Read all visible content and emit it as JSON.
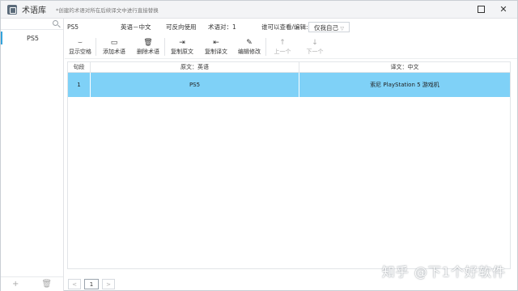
{
  "titlebar": {
    "title": "术语库",
    "subtitle": "*创建的术语对所在后续译文中进行直接替换"
  },
  "sidebar": {
    "items": [
      {
        "label": "PS5"
      }
    ]
  },
  "info": {
    "term_name": "PS5",
    "language_pair": "英语－中文",
    "reversible": "可反向使用",
    "term_count": "术语对：1",
    "visibility_label": "谁可以查看/编辑:",
    "visibility_value": "仅我自己"
  },
  "toolbar": {
    "show_space": "显示空格",
    "add_term": "添加术语",
    "delete_term": "删除术语",
    "copy_source": "复制原文",
    "copy_target": "复制译文",
    "edit": "编辑修改",
    "prev": "上一个",
    "next": "下一个"
  },
  "table": {
    "headers": [
      "句段",
      "原文：英语",
      "译文：中文"
    ],
    "rows": [
      {
        "index": "1",
        "source": "PS5",
        "target": "索尼 PlayStation 5 游戏机"
      }
    ]
  },
  "pager": {
    "page": "1"
  },
  "watermark": "知乎 @下1个好软件",
  "colors": {
    "selected_row": "#7fd1f7",
    "accent": "#33a3dc"
  },
  "icons": [
    "app-icon",
    "search-icon",
    "space-icon",
    "monitor-icon",
    "trash-icon",
    "copy-source-icon",
    "copy-target-icon",
    "pen-icon",
    "arrow-up-icon",
    "arrow-down-icon",
    "plus-icon",
    "trash-icon",
    "chevron-left-icon",
    "chevron-right-icon"
  ]
}
